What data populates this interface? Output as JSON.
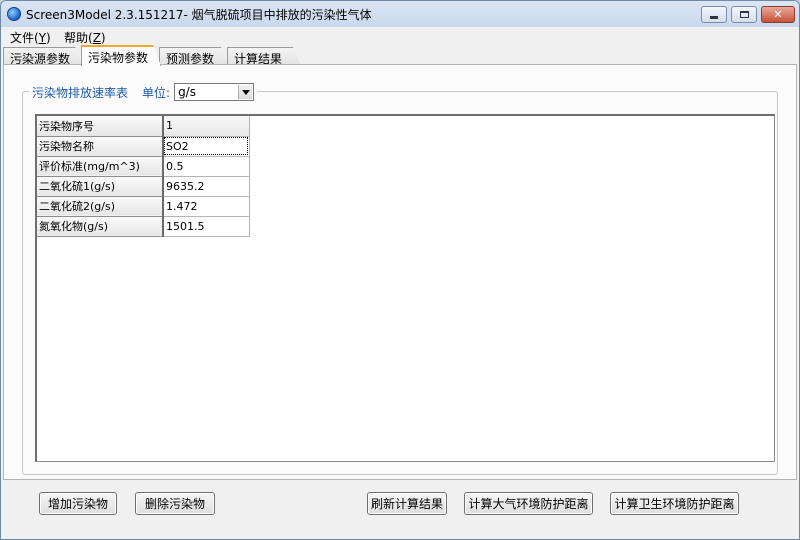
{
  "window": {
    "title": "Screen3Model 2.3.151217- 烟气脱硫项目中排放的污染性气体"
  },
  "menu": {
    "items": [
      {
        "label": "文件(",
        "key": "Y",
        "suffix": ")"
      },
      {
        "label": "帮助(",
        "key": "Z",
        "suffix": ")"
      }
    ]
  },
  "tabs": [
    {
      "label": "污染源参数"
    },
    {
      "label": "污染物参数"
    },
    {
      "label": "预测参数"
    },
    {
      "label": "计算结果"
    }
  ],
  "active_tab": 1,
  "group": {
    "title": "污染物排放速率表",
    "unit_label": "单位:",
    "unit_value": "g/s"
  },
  "grid": {
    "rows": [
      {
        "header": "污染物序号",
        "value": "1"
      },
      {
        "header": "污染物名称",
        "value": "SO2"
      },
      {
        "header": "评价标准(mg/m^3)",
        "value": "0.5"
      },
      {
        "header": "二氧化硫1(g/s)",
        "value": "9635.2"
      },
      {
        "header": "二氧化硫2(g/s)",
        "value": "1.472"
      },
      {
        "header": "氮氧化物(g/s)",
        "value": "1501.5"
      }
    ]
  },
  "buttons": {
    "add_pollutant": "增加污染物",
    "delete_pollutant": "删除污染物",
    "refresh_results": "刷新计算结果",
    "calc_atmos_distance": "计算大气环境防护距离",
    "calc_health_distance": "计算卫生环境防护距离"
  },
  "colors": {
    "accent_tab": "#f0a830",
    "group_title": "#1e5aa8",
    "close_button": "#c7523b"
  }
}
